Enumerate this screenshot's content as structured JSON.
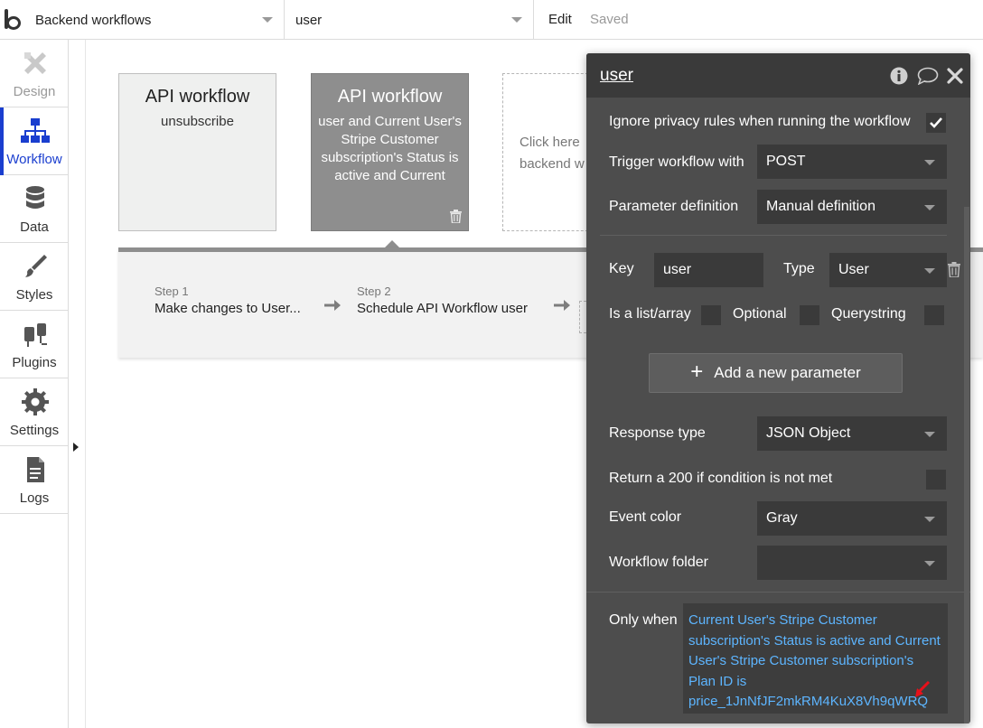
{
  "topbar": {
    "page_selector": "Backend workflows",
    "workflow_selector": "user",
    "edit": "Edit",
    "saved": "Saved"
  },
  "nav": [
    {
      "label": "Design",
      "icon": "design-icon",
      "state": "disabled"
    },
    {
      "label": "Workflow",
      "icon": "workflow-icon",
      "state": "active"
    },
    {
      "label": "Data",
      "icon": "database-icon",
      "state": "normal"
    },
    {
      "label": "Styles",
      "icon": "brush-icon",
      "state": "normal"
    },
    {
      "label": "Plugins",
      "icon": "plug-icon",
      "state": "normal"
    },
    {
      "label": "Settings",
      "icon": "gear-icon",
      "state": "normal"
    },
    {
      "label": "Logs",
      "icon": "document-icon",
      "state": "normal"
    }
  ],
  "cards": [
    {
      "title": "API workflow",
      "subtitle": "unsubscribe"
    },
    {
      "title": "API workflow",
      "subtitle": "user and Current User's Stripe Customer subscription's Status is active and Current"
    },
    {
      "subtitle_line1": "Click here",
      "subtitle_line2": "backend w"
    }
  ],
  "steps": [
    {
      "number": "Step 1",
      "name": "Make changes to User..."
    },
    {
      "number": "Step 2",
      "name": "Schedule API Workflow user"
    }
  ],
  "panel": {
    "title": "user",
    "ignore_privacy_label": "Ignore privacy rules when running the workflow",
    "ignore_privacy_checked": true,
    "trigger_label": "Trigger workflow with",
    "trigger_value": "POST",
    "param_def_label": "Parameter definition",
    "param_def_value": "Manual definition",
    "key_label": "Key",
    "key_value": "user",
    "type_label": "Type",
    "type_value": "User",
    "is_list_label": "Is a list/array",
    "optional_label": "Optional",
    "querystring_label": "Querystring",
    "add_param_label": "Add a new parameter",
    "response_label": "Response type",
    "response_value": "JSON Object",
    "return200_label": "Return a 200 if condition is not met",
    "event_color_label": "Event color",
    "event_color_value": "Gray",
    "folder_label": "Workflow folder",
    "folder_value": "",
    "only_when_label": "Only when",
    "only_when_value": "Current User's Stripe Customer subscription's Status is active and Current User's Stripe Customer subscription's Plan ID is price_1JnNfJF2mkRM4KuX8Vh9qWRQ"
  },
  "colors": {
    "accent": "#1a3ecf",
    "panel_bg": "#4d4d4d",
    "panel_field": "#3a3a3a",
    "condition_text": "#5db5ff",
    "card_active": "#8e8e8e",
    "annotation_arrow": "#e8101a"
  }
}
